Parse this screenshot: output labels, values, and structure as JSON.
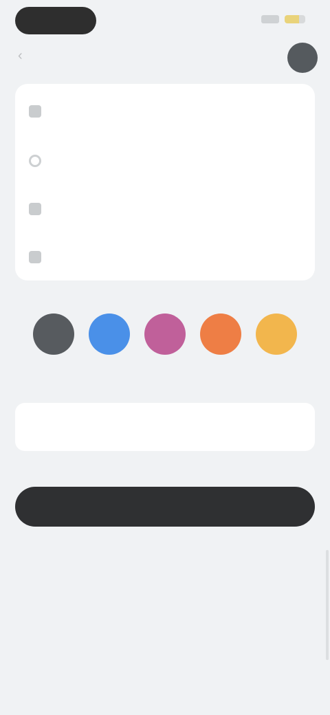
{
  "header": {
    "back_icon": "chevron-left-icon",
    "avatar_icon": "avatar"
  },
  "options": [
    {
      "label": "",
      "icon": "grid-icon"
    },
    {
      "label": "",
      "icon": "clock-icon"
    },
    {
      "label": "",
      "icon": "image-icon"
    },
    {
      "label": "",
      "icon": "document-icon"
    }
  ],
  "swatches": [
    {
      "color": "#575b5f"
    },
    {
      "color": "#4a90e8"
    },
    {
      "color": "#c0609a"
    },
    {
      "color": "#ee7e45"
    },
    {
      "color": "#f2b64d"
    }
  ],
  "field": {
    "label": ""
  },
  "primary_button": {
    "label": ""
  },
  "links": [
    "",
    "",
    "",
    "",
    ""
  ]
}
